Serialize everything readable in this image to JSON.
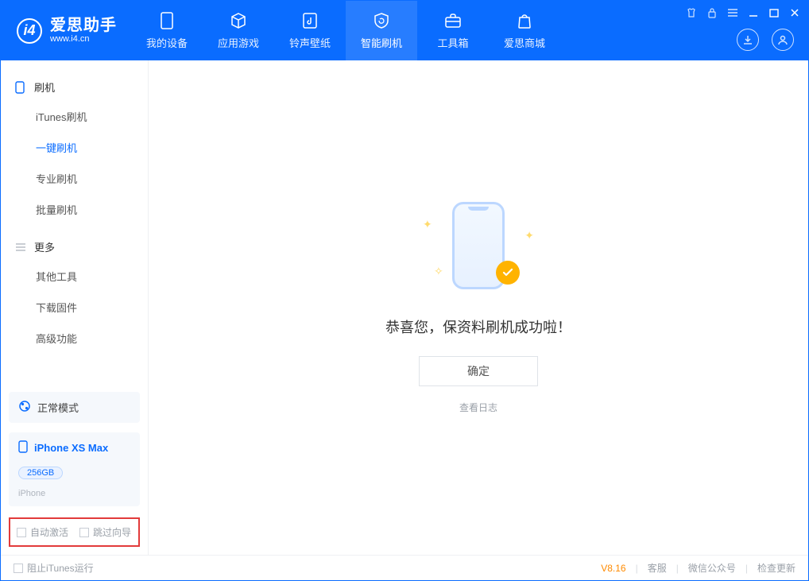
{
  "brand": {
    "cn": "爱思助手",
    "url": "www.i4.cn"
  },
  "nav": {
    "device": "我的设备",
    "apps": "应用游戏",
    "ringtone": "铃声壁纸",
    "flash": "智能刷机",
    "toolbox": "工具箱",
    "store": "爱思商城"
  },
  "sidebar": {
    "group_flash": "刷机",
    "items_flash": {
      "itunes": "iTunes刷机",
      "onekey": "一键刷机",
      "pro": "专业刷机",
      "batch": "批量刷机"
    },
    "group_more": "更多",
    "items_more": {
      "other": "其他工具",
      "firmware": "下载固件",
      "advanced": "高级功能"
    },
    "mode": "正常模式",
    "device_name": "iPhone XS Max",
    "device_storage": "256GB",
    "device_type": "iPhone",
    "auto_activate": "自动激活",
    "skip_guide": "跳过向导"
  },
  "content": {
    "title": "恭喜您，保资料刷机成功啦！",
    "ok": "确定",
    "view_log": "查看日志"
  },
  "status": {
    "block_itunes": "阻止iTunes运行",
    "version": "V8.16",
    "support": "客服",
    "wechat": "微信公众号",
    "update": "检查更新"
  }
}
